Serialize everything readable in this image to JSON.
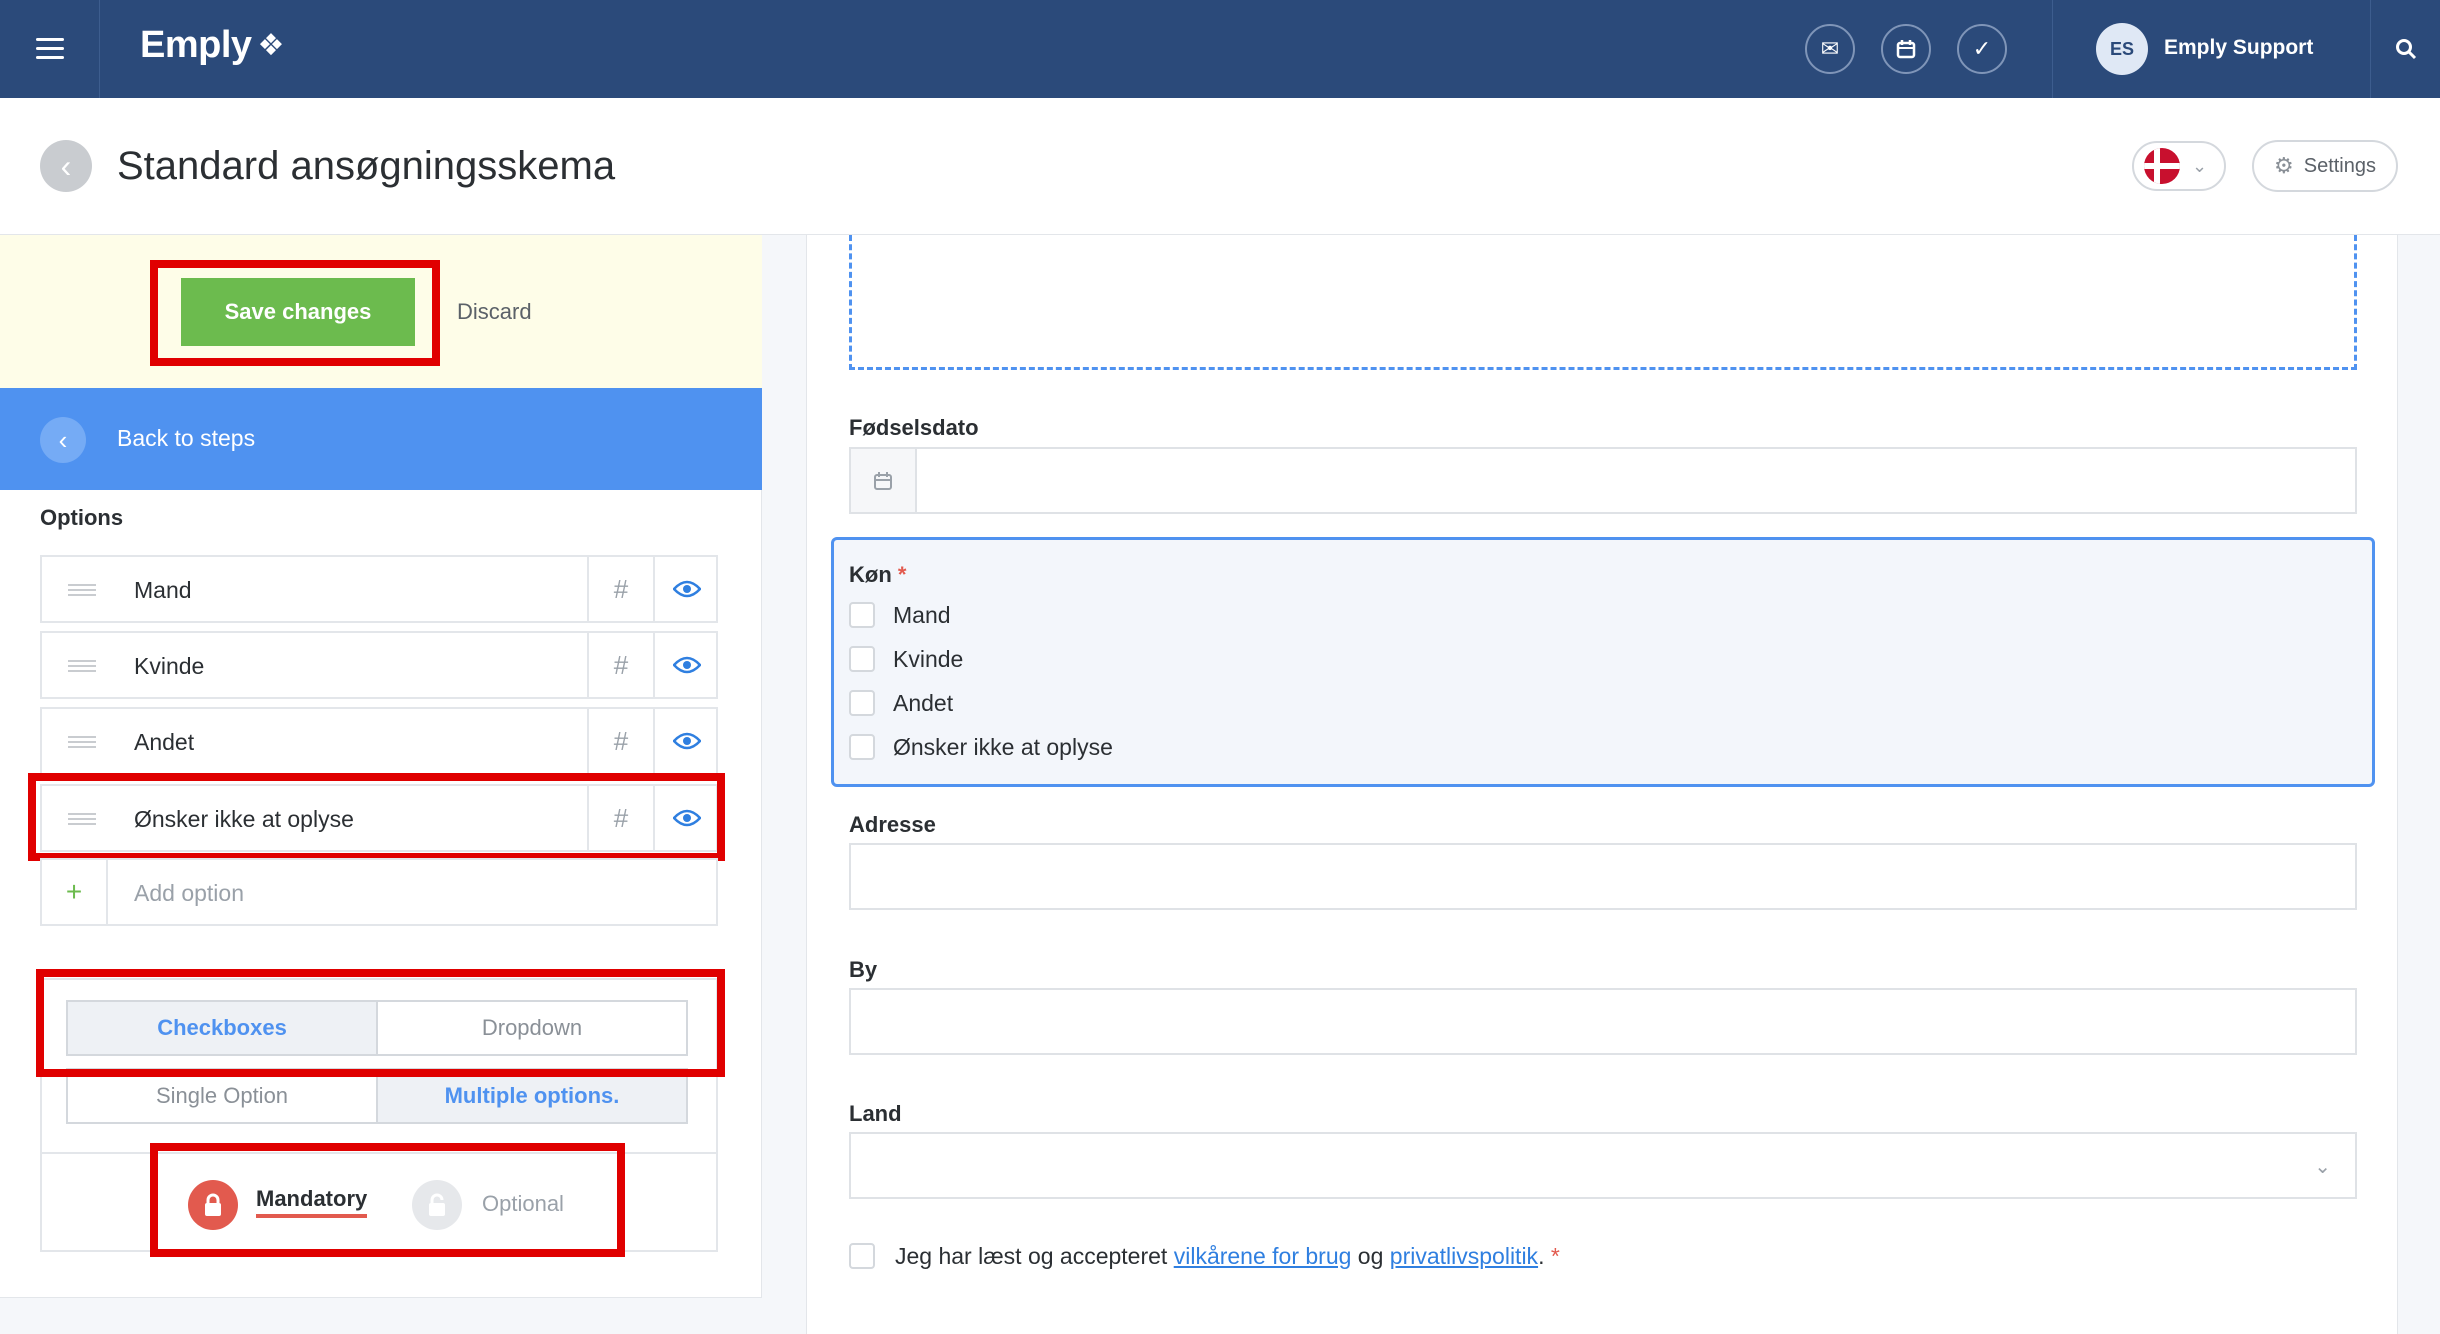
{
  "topbar": {
    "brand": "Emply",
    "user_initials": "ES",
    "user_name": "Emply Support",
    "icons": [
      "mail-icon",
      "calendar-icon",
      "check-icon",
      "search-icon"
    ]
  },
  "header": {
    "title": "Standard ansøgningsskema",
    "settings_label": "Settings"
  },
  "editor": {
    "save_label": "Save changes",
    "discard_label": "Discard",
    "back_label": "Back to steps",
    "options_title": "Options",
    "options": [
      {
        "label": "Mand"
      },
      {
        "label": "Kvinde"
      },
      {
        "label": "Andet"
      },
      {
        "label": "Ønsker ikke at oplyse"
      }
    ],
    "add_option_placeholder": "Add option",
    "type_segments": {
      "checkboxes": "Checkboxes",
      "dropdown": "Dropdown",
      "single": "Single Option",
      "multiple": "Multiple options."
    },
    "mandatory_label": "Mandatory",
    "optional_label": "Optional"
  },
  "form": {
    "birthdate_label": "Fødselsdato",
    "gender_label": "Køn",
    "gender_required_mark": "*",
    "gender_options": [
      "Mand",
      "Kvinde",
      "Andet",
      "Ønsker ikke at oplyse"
    ],
    "address_label": "Adresse",
    "city_label": "By",
    "country_label": "Land",
    "terms_prefix": "Jeg har læst og accepteret ",
    "terms_link1": "vilkårene for brug",
    "terms_mid": " og ",
    "terms_link2": "privatlivspolitik",
    "terms_suffix": ".",
    "terms_required_mark": "*"
  },
  "colors": {
    "topbar": "#2b4a7a",
    "accent_blue": "#4f92f0",
    "save_green": "#6cbb4e",
    "highlight_red": "#e00000",
    "mandatory_red": "#e25a4e"
  }
}
